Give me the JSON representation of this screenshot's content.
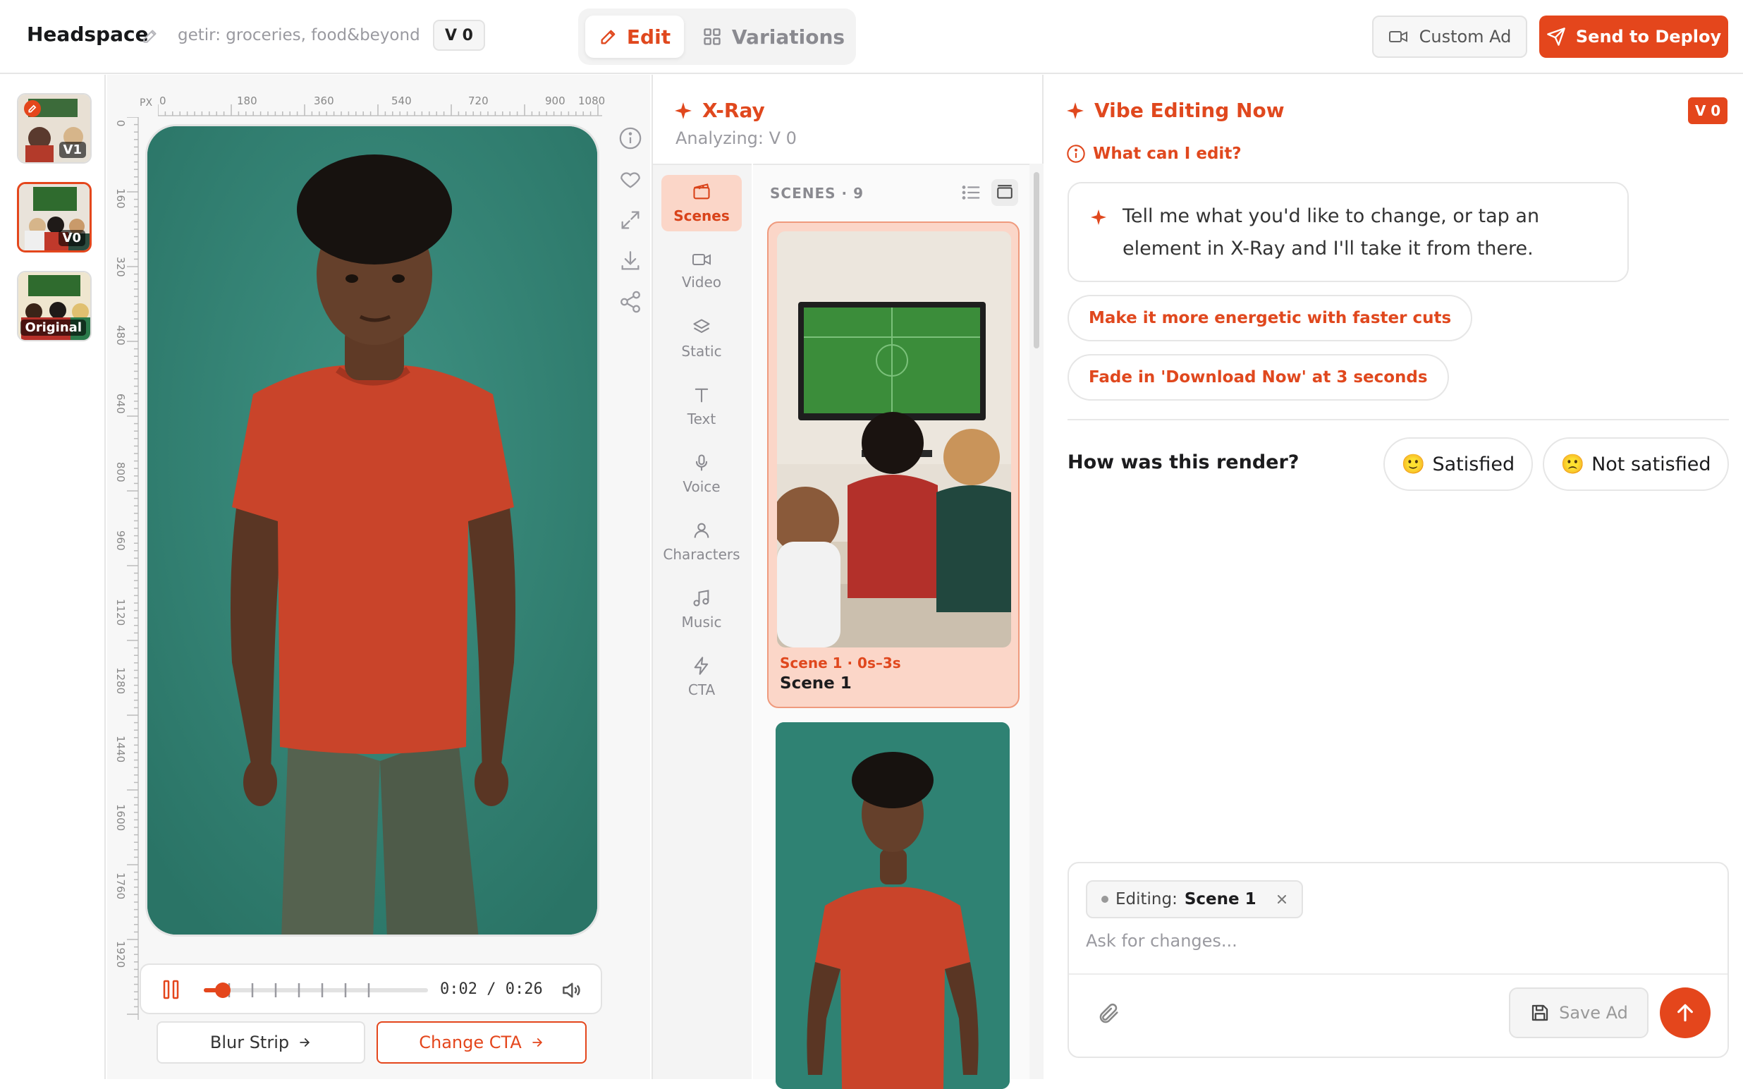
{
  "header": {
    "brand": "Headspace",
    "product": "getir: groceries, food&beyond",
    "version": "V 0",
    "tabs": [
      {
        "label": "Edit",
        "icon": "pencil-icon",
        "active": true
      },
      {
        "label": "Variations",
        "icon": "grid-icon",
        "active": false
      }
    ],
    "custom_ad_label": "Custom Ad",
    "deploy_label": "Send to Deploy"
  },
  "versions": [
    {
      "label": "V1",
      "selected": false,
      "edited": true
    },
    {
      "label": "V0",
      "selected": true,
      "edited": false
    },
    {
      "label": "Original",
      "selected": false,
      "edited": false
    }
  ],
  "canvas": {
    "ruler_unit": "PX",
    "ruler_top": [
      "0",
      "180",
      "360",
      "540",
      "720",
      "900",
      "1080"
    ],
    "ruler_left": [
      "0",
      "160",
      "320",
      "480",
      "640",
      "800",
      "960",
      "1120",
      "1280",
      "1440",
      "1600",
      "1760",
      "1920"
    ],
    "side_tools": [
      "info-icon",
      "heart-icon",
      "expand-icon",
      "download-icon",
      "share-icon"
    ],
    "player": {
      "time": "0:02 / 0:26",
      "progress": 0.077
    },
    "actions": [
      {
        "label": "Blur Strip",
        "style": "neutral"
      },
      {
        "label": "Change CTA",
        "style": "accent"
      }
    ]
  },
  "xray": {
    "title": "X-Ray",
    "subtitle": "Analyzing: V 0",
    "categories": [
      {
        "label": "Scenes",
        "icon": "film-icon",
        "active": true
      },
      {
        "label": "Video",
        "icon": "video-icon",
        "active": false
      },
      {
        "label": "Static",
        "icon": "layers-icon",
        "active": false
      },
      {
        "label": "Text",
        "icon": "text-icon",
        "active": false
      },
      {
        "label": "Voice",
        "icon": "mic-icon",
        "active": false
      },
      {
        "label": "Characters",
        "icon": "person-icon",
        "active": false
      },
      {
        "label": "Music",
        "icon": "music-icon",
        "active": false
      },
      {
        "label": "CTA",
        "icon": "bolt-icon",
        "active": false
      }
    ],
    "scenes_header": "SCENES · 9",
    "scenes": [
      {
        "meta": "Scene 1 · 0s–3s",
        "name": "Scene 1",
        "selected": true
      }
    ]
  },
  "vibe": {
    "title": "Vibe Editing Now",
    "version_badge": "V 0",
    "help_link": "What can I edit?",
    "intro": "Tell me what you'd like to change, or tap an element in X-Ray and I'll take it from there.",
    "suggestions": [
      "Make it more energetic with faster cuts",
      "Fade in 'Download Now' at 3 seconds"
    ],
    "rating_question": "How was this render?",
    "rating_options": [
      {
        "emoji": "🙂",
        "label": "Satisfied"
      },
      {
        "emoji": "🙁",
        "label": "Not satisfied"
      }
    ],
    "composer": {
      "editing_label": "Editing:",
      "editing_target": "Scene 1",
      "placeholder": "Ask for changes...",
      "save_label": "Save Ad"
    }
  },
  "colors": {
    "accent": "#e4461c",
    "accent_soft": "#fbd6c8",
    "teal_bg": "#2f8273",
    "shirt": "#c9442a"
  }
}
